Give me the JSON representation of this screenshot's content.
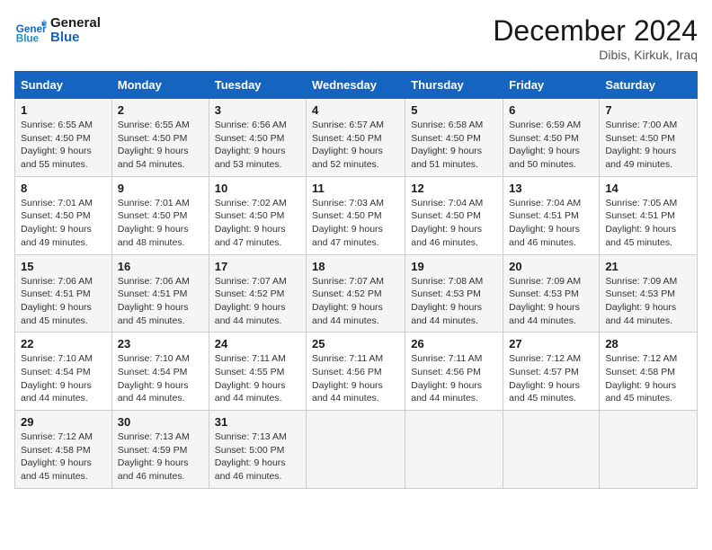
{
  "header": {
    "logo_line1": "General",
    "logo_line2": "Blue",
    "month": "December 2024",
    "location": "Dibis, Kirkuk, Iraq"
  },
  "days_of_week": [
    "Sunday",
    "Monday",
    "Tuesday",
    "Wednesday",
    "Thursday",
    "Friday",
    "Saturday"
  ],
  "weeks": [
    [
      {
        "num": "1",
        "rise": "6:55 AM",
        "set": "4:50 PM",
        "daylight": "9 hours and 55 minutes."
      },
      {
        "num": "2",
        "rise": "6:55 AM",
        "set": "4:50 PM",
        "daylight": "9 hours and 54 minutes."
      },
      {
        "num": "3",
        "rise": "6:56 AM",
        "set": "4:50 PM",
        "daylight": "9 hours and 53 minutes."
      },
      {
        "num": "4",
        "rise": "6:57 AM",
        "set": "4:50 PM",
        "daylight": "9 hours and 52 minutes."
      },
      {
        "num": "5",
        "rise": "6:58 AM",
        "set": "4:50 PM",
        "daylight": "9 hours and 51 minutes."
      },
      {
        "num": "6",
        "rise": "6:59 AM",
        "set": "4:50 PM",
        "daylight": "9 hours and 50 minutes."
      },
      {
        "num": "7",
        "rise": "7:00 AM",
        "set": "4:50 PM",
        "daylight": "9 hours and 49 minutes."
      }
    ],
    [
      {
        "num": "8",
        "rise": "7:01 AM",
        "set": "4:50 PM",
        "daylight": "9 hours and 49 minutes."
      },
      {
        "num": "9",
        "rise": "7:01 AM",
        "set": "4:50 PM",
        "daylight": "9 hours and 48 minutes."
      },
      {
        "num": "10",
        "rise": "7:02 AM",
        "set": "4:50 PM",
        "daylight": "9 hours and 47 minutes."
      },
      {
        "num": "11",
        "rise": "7:03 AM",
        "set": "4:50 PM",
        "daylight": "9 hours and 47 minutes."
      },
      {
        "num": "12",
        "rise": "7:04 AM",
        "set": "4:50 PM",
        "daylight": "9 hours and 46 minutes."
      },
      {
        "num": "13",
        "rise": "7:04 AM",
        "set": "4:51 PM",
        "daylight": "9 hours and 46 minutes."
      },
      {
        "num": "14",
        "rise": "7:05 AM",
        "set": "4:51 PM",
        "daylight": "9 hours and 45 minutes."
      }
    ],
    [
      {
        "num": "15",
        "rise": "7:06 AM",
        "set": "4:51 PM",
        "daylight": "9 hours and 45 minutes."
      },
      {
        "num": "16",
        "rise": "7:06 AM",
        "set": "4:51 PM",
        "daylight": "9 hours and 45 minutes."
      },
      {
        "num": "17",
        "rise": "7:07 AM",
        "set": "4:52 PM",
        "daylight": "9 hours and 44 minutes."
      },
      {
        "num": "18",
        "rise": "7:07 AM",
        "set": "4:52 PM",
        "daylight": "9 hours and 44 minutes."
      },
      {
        "num": "19",
        "rise": "7:08 AM",
        "set": "4:53 PM",
        "daylight": "9 hours and 44 minutes."
      },
      {
        "num": "20",
        "rise": "7:09 AM",
        "set": "4:53 PM",
        "daylight": "9 hours and 44 minutes."
      },
      {
        "num": "21",
        "rise": "7:09 AM",
        "set": "4:53 PM",
        "daylight": "9 hours and 44 minutes."
      }
    ],
    [
      {
        "num": "22",
        "rise": "7:10 AM",
        "set": "4:54 PM",
        "daylight": "9 hours and 44 minutes."
      },
      {
        "num": "23",
        "rise": "7:10 AM",
        "set": "4:54 PM",
        "daylight": "9 hours and 44 minutes."
      },
      {
        "num": "24",
        "rise": "7:11 AM",
        "set": "4:55 PM",
        "daylight": "9 hours and 44 minutes."
      },
      {
        "num": "25",
        "rise": "7:11 AM",
        "set": "4:56 PM",
        "daylight": "9 hours and 44 minutes."
      },
      {
        "num": "26",
        "rise": "7:11 AM",
        "set": "4:56 PM",
        "daylight": "9 hours and 44 minutes."
      },
      {
        "num": "27",
        "rise": "7:12 AM",
        "set": "4:57 PM",
        "daylight": "9 hours and 45 minutes."
      },
      {
        "num": "28",
        "rise": "7:12 AM",
        "set": "4:58 PM",
        "daylight": "9 hours and 45 minutes."
      }
    ],
    [
      {
        "num": "29",
        "rise": "7:12 AM",
        "set": "4:58 PM",
        "daylight": "9 hours and 45 minutes."
      },
      {
        "num": "30",
        "rise": "7:13 AM",
        "set": "4:59 PM",
        "daylight": "9 hours and 46 minutes."
      },
      {
        "num": "31",
        "rise": "7:13 AM",
        "set": "5:00 PM",
        "daylight": "9 hours and 46 minutes."
      },
      null,
      null,
      null,
      null
    ]
  ]
}
